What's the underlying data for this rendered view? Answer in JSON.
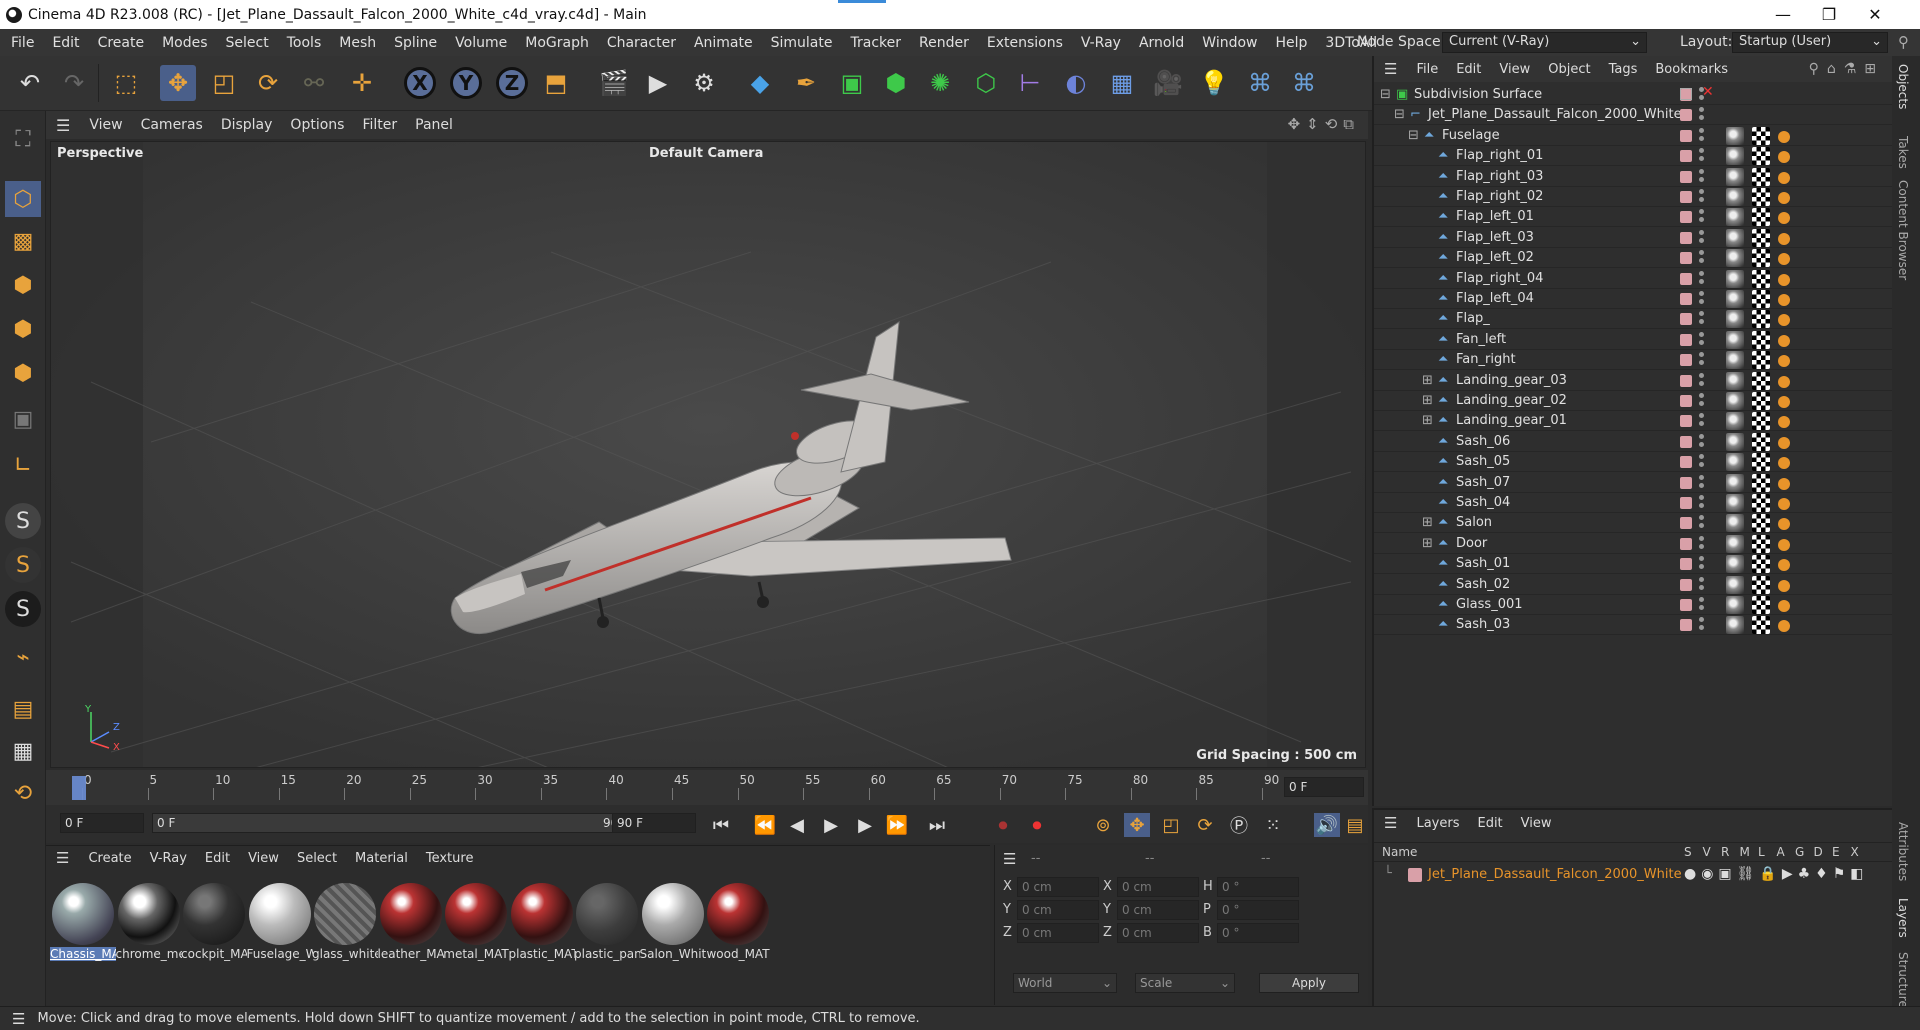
{
  "window": {
    "title": "Cinema 4D R23.008 (RC) - [Jet_Plane_Dassault_Falcon_2000_White_c4d_vray.c4d] - Main",
    "minimize": "—",
    "maximize": "❐",
    "close": "✕"
  },
  "menubar": {
    "items": [
      "File",
      "Edit",
      "Create",
      "Modes",
      "Select",
      "Tools",
      "Mesh",
      "Spline",
      "Volume",
      "MoGraph",
      "Character",
      "Animate",
      "Simulate",
      "Tracker",
      "Render",
      "Extensions",
      "V-Ray",
      "Arnold",
      "Window",
      "Help",
      "3DToAll"
    ],
    "node_space_label": "Node Space:",
    "node_space_value": "Current (V-Ray)",
    "layout_label": "Layout:",
    "layout_value": "Startup (User)"
  },
  "toolbar": {
    "x_label": "X",
    "y_label": "Y",
    "z_label": "Z"
  },
  "viewport": {
    "menu": [
      "View",
      "Cameras",
      "Display",
      "Options",
      "Filter",
      "Panel"
    ],
    "name": "Perspective",
    "camera": "Default Camera",
    "grid_spacing": "Grid Spacing : 500 cm",
    "axis_y": "Y",
    "axis_z": "Z",
    "axis_x": "X"
  },
  "timeline": {
    "ticks": [
      "0",
      "5",
      "10",
      "15",
      "20",
      "25",
      "30",
      "35",
      "40",
      "45",
      "50",
      "55",
      "60",
      "65",
      "70",
      "75",
      "80",
      "85",
      "90"
    ],
    "current_frame": "0 F"
  },
  "transport": {
    "start": "0 F",
    "range_start": "0 F",
    "range_end": "90 F",
    "end": "90 F"
  },
  "materials": {
    "menu": [
      "Create",
      "V-Ray",
      "Edit",
      "View",
      "Select",
      "Material",
      "Texture"
    ],
    "items": [
      {
        "name": "Chassis_MA",
        "selected": true
      },
      {
        "name": "chrome_me"
      },
      {
        "name": "cockpit_MA"
      },
      {
        "name": "Fuselage_W"
      },
      {
        "name": "glass_white"
      },
      {
        "name": "leather_MA"
      },
      {
        "name": "metal_MAT"
      },
      {
        "name": "plastic_MAT"
      },
      {
        "name": "plastic_pane"
      },
      {
        "name": "Salon_White"
      },
      {
        "name": "wood_MAT"
      }
    ]
  },
  "coords": {
    "header": [
      "--",
      "--",
      "--"
    ],
    "rows": [
      {
        "l1": "X",
        "v1": "0 cm",
        "l2": "X",
        "v2": "0 cm",
        "l3": "H",
        "v3": "0 °"
      },
      {
        "l1": "Y",
        "v1": "0 cm",
        "l2": "Y",
        "v2": "0 cm",
        "l3": "P",
        "v3": "0 °"
      },
      {
        "l1": "Z",
        "v1": "0 cm",
        "l2": "Z",
        "v2": "0 cm",
        "l3": "B",
        "v3": "0 °"
      }
    ],
    "world": "World",
    "scale": "Scale",
    "apply": "Apply"
  },
  "status": "Move: Click and drag to move elements. Hold down SHIFT to quantize movement / add to the selection in point mode, CTRL to remove.",
  "objects": {
    "menu": [
      "File",
      "Edit",
      "View",
      "Object",
      "Tags",
      "Bookmarks"
    ],
    "rows": [
      {
        "name": "Subdivision Surface",
        "indent": 0,
        "expand": "⊟",
        "icon": "subdiv"
      },
      {
        "name": "Jet_Plane_Dassault_Falcon_2000_White",
        "indent": 1,
        "expand": "⊟",
        "icon": "null"
      },
      {
        "name": "Fuselage",
        "indent": 2,
        "expand": "⊟",
        "icon": "poly"
      },
      {
        "name": "Flap_right_01",
        "indent": 3,
        "expand": "",
        "icon": "poly"
      },
      {
        "name": "Flap_right_03",
        "indent": 3,
        "expand": "",
        "icon": "poly"
      },
      {
        "name": "Flap_right_02",
        "indent": 3,
        "expand": "",
        "icon": "poly"
      },
      {
        "name": "Flap_left_01",
        "indent": 3,
        "expand": "",
        "icon": "poly"
      },
      {
        "name": "Flap_left_03",
        "indent": 3,
        "expand": "",
        "icon": "poly"
      },
      {
        "name": "Flap_left_02",
        "indent": 3,
        "expand": "",
        "icon": "poly"
      },
      {
        "name": "Flap_right_04",
        "indent": 3,
        "expand": "",
        "icon": "poly"
      },
      {
        "name": "Flap_left_04",
        "indent": 3,
        "expand": "",
        "icon": "poly"
      },
      {
        "name": "Flap_",
        "indent": 3,
        "expand": "",
        "icon": "poly"
      },
      {
        "name": "Fan_left",
        "indent": 3,
        "expand": "",
        "icon": "poly"
      },
      {
        "name": "Fan_right",
        "indent": 3,
        "expand": "",
        "icon": "poly"
      },
      {
        "name": "Landing_gear_03",
        "indent": 3,
        "expand": "⊞",
        "icon": "poly"
      },
      {
        "name": "Landing_gear_02",
        "indent": 3,
        "expand": "⊞",
        "icon": "poly"
      },
      {
        "name": "Landing_gear_01",
        "indent": 3,
        "expand": "⊞",
        "icon": "poly"
      },
      {
        "name": "Sash_06",
        "indent": 3,
        "expand": "",
        "icon": "poly"
      },
      {
        "name": "Sash_05",
        "indent": 3,
        "expand": "",
        "icon": "poly"
      },
      {
        "name": "Sash_07",
        "indent": 3,
        "expand": "",
        "icon": "poly"
      },
      {
        "name": "Sash_04",
        "indent": 3,
        "expand": "",
        "icon": "poly"
      },
      {
        "name": "Salon",
        "indent": 3,
        "expand": "⊞",
        "icon": "poly"
      },
      {
        "name": "Door",
        "indent": 3,
        "expand": "⊞",
        "icon": "poly"
      },
      {
        "name": "Sash_01",
        "indent": 3,
        "expand": "",
        "icon": "poly"
      },
      {
        "name": "Sash_02",
        "indent": 3,
        "expand": "",
        "icon": "poly"
      },
      {
        "name": "Glass_001",
        "indent": 3,
        "expand": "",
        "icon": "poly"
      },
      {
        "name": "Sash_03",
        "indent": 3,
        "expand": "",
        "icon": "poly"
      }
    ]
  },
  "layers": {
    "menu": [
      "Layers",
      "Edit",
      "View"
    ],
    "columns": [
      "Name",
      "S",
      "V",
      "R",
      "M",
      "L",
      "A",
      "G",
      "D",
      "E",
      "X"
    ],
    "rows": [
      {
        "name": "Jet_Plane_Dassault_Falcon_2000_White",
        "color": "#e8942a"
      }
    ]
  },
  "right_tabs": [
    "Objects",
    "Takes",
    "Content Browser",
    "Attributes",
    "Layers",
    "Structure"
  ],
  "colors": {
    "accent": "#e8a33c",
    "selection": "#5b7bb5",
    "layer_name": "#e8942a"
  }
}
